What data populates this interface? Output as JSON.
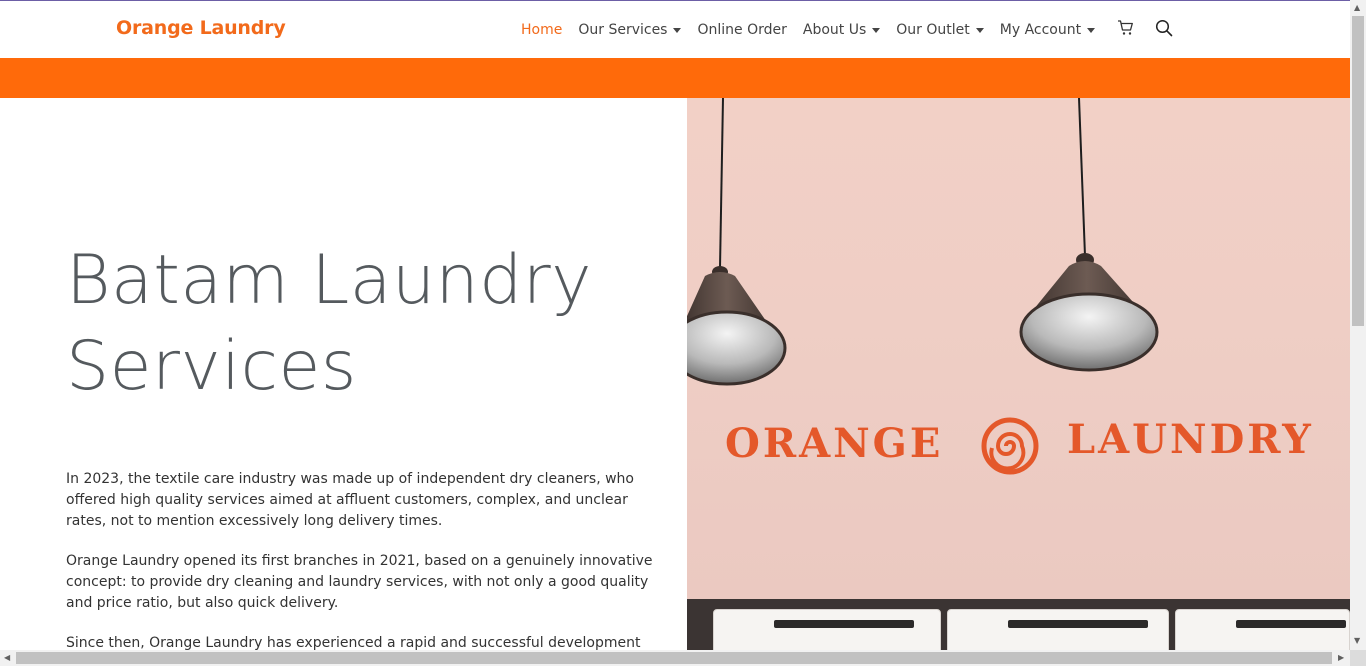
{
  "brand": {
    "name": "Orange Laundry"
  },
  "nav": {
    "items": [
      {
        "label": "Home",
        "active": true,
        "dropdown": false
      },
      {
        "label": "Our Services",
        "active": false,
        "dropdown": true
      },
      {
        "label": "Online Order",
        "active": false,
        "dropdown": false
      },
      {
        "label": "About Us",
        "active": false,
        "dropdown": true
      },
      {
        "label": "Our Outlet",
        "active": false,
        "dropdown": true
      },
      {
        "label": "My Account",
        "active": false,
        "dropdown": true
      }
    ],
    "cart_icon": "cart-icon",
    "search_icon": "search-icon"
  },
  "hero": {
    "title_line1": "Batam Laundry",
    "title_line2": "Services",
    "paragraphs": [
      "In 2023, the textile care industry was made up of independent dry cleaners, who offered high quality services aimed at affluent customers, complex, and unclear rates, not to mention excessively long delivery times.",
      "Orange Laundry opened its first branches in 2021, based on a genuinely innovative concept: to provide dry cleaning and laundry services, with not only a good quality and price ratio, but also quick delivery.",
      "Since then, Orange Laundry has experienced a rapid and successful development"
    ],
    "wall_sign_left": "ORANGE",
    "wall_sign_right": "LAUNDRY"
  },
  "colors": {
    "accent": "#f26a1b",
    "band": "#ff6a0a",
    "title": "#555a5e"
  }
}
